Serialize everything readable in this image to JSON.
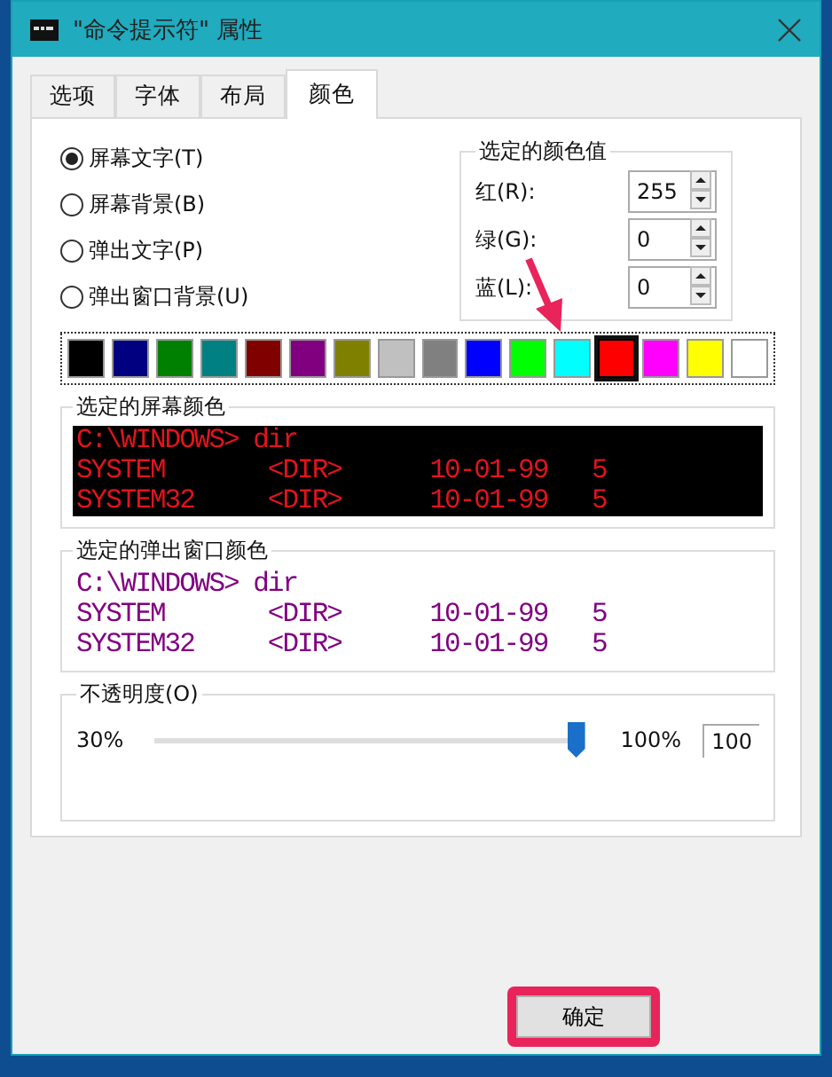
{
  "window": {
    "title": "\"命令提示符\" 属性"
  },
  "tabs": [
    {
      "label": "选项",
      "selected": false
    },
    {
      "label": "字体",
      "selected": false
    },
    {
      "label": "布局",
      "selected": false
    },
    {
      "label": "颜色",
      "selected": true
    }
  ],
  "targets": [
    {
      "label": "屏幕文字(T)",
      "selected": true
    },
    {
      "label": "屏幕背景(B)",
      "selected": false
    },
    {
      "label": "弹出文字(P)",
      "selected": false
    },
    {
      "label": "弹出窗口背景(U)",
      "selected": false
    }
  ],
  "color_values": {
    "title": "选定的颜色值",
    "fields": [
      {
        "label": "红(R):",
        "value": "255"
      },
      {
        "label": "绿(G):",
        "value": "0"
      },
      {
        "label": "蓝(L):",
        "value": "0"
      }
    ]
  },
  "swatches": [
    {
      "color": "#000000",
      "selected": false
    },
    {
      "color": "#000080",
      "selected": false
    },
    {
      "color": "#008000",
      "selected": false
    },
    {
      "color": "#008080",
      "selected": false
    },
    {
      "color": "#800000",
      "selected": false
    },
    {
      "color": "#800080",
      "selected": false
    },
    {
      "color": "#808000",
      "selected": false
    },
    {
      "color": "#c0c0c0",
      "selected": false
    },
    {
      "color": "#808080",
      "selected": false
    },
    {
      "color": "#0000ff",
      "selected": false
    },
    {
      "color": "#00ff00",
      "selected": false
    },
    {
      "color": "#00ffff",
      "selected": false
    },
    {
      "color": "#ff0000",
      "selected": true
    },
    {
      "color": "#ff00ff",
      "selected": false
    },
    {
      "color": "#ffff00",
      "selected": false
    },
    {
      "color": "#ffffff",
      "selected": false
    }
  ],
  "previews": [
    {
      "title": "选定的屏幕颜色",
      "kind": "screen",
      "color": "#e0141e",
      "lines": [
        "C:\\WINDOWS> dir",
        "SYSTEM       <DIR>      10-01-99   5",
        "SYSTEM32     <DIR>      10-01-99   5"
      ]
    },
    {
      "title": "选定的弹出窗口颜色",
      "kind": "popup",
      "color": "#800080",
      "lines": [
        "C:\\WINDOWS> dir",
        "SYSTEM       <DIR>      10-01-99   5",
        "SYSTEM32     <DIR>      10-01-99   5"
      ]
    }
  ],
  "opacity": {
    "title": "不透明度(O)",
    "min_label": "30%",
    "max_label": "100%",
    "level": 1,
    "value": "100"
  },
  "buttons": [
    {
      "label": "确定",
      "highlighted": true
    }
  ]
}
